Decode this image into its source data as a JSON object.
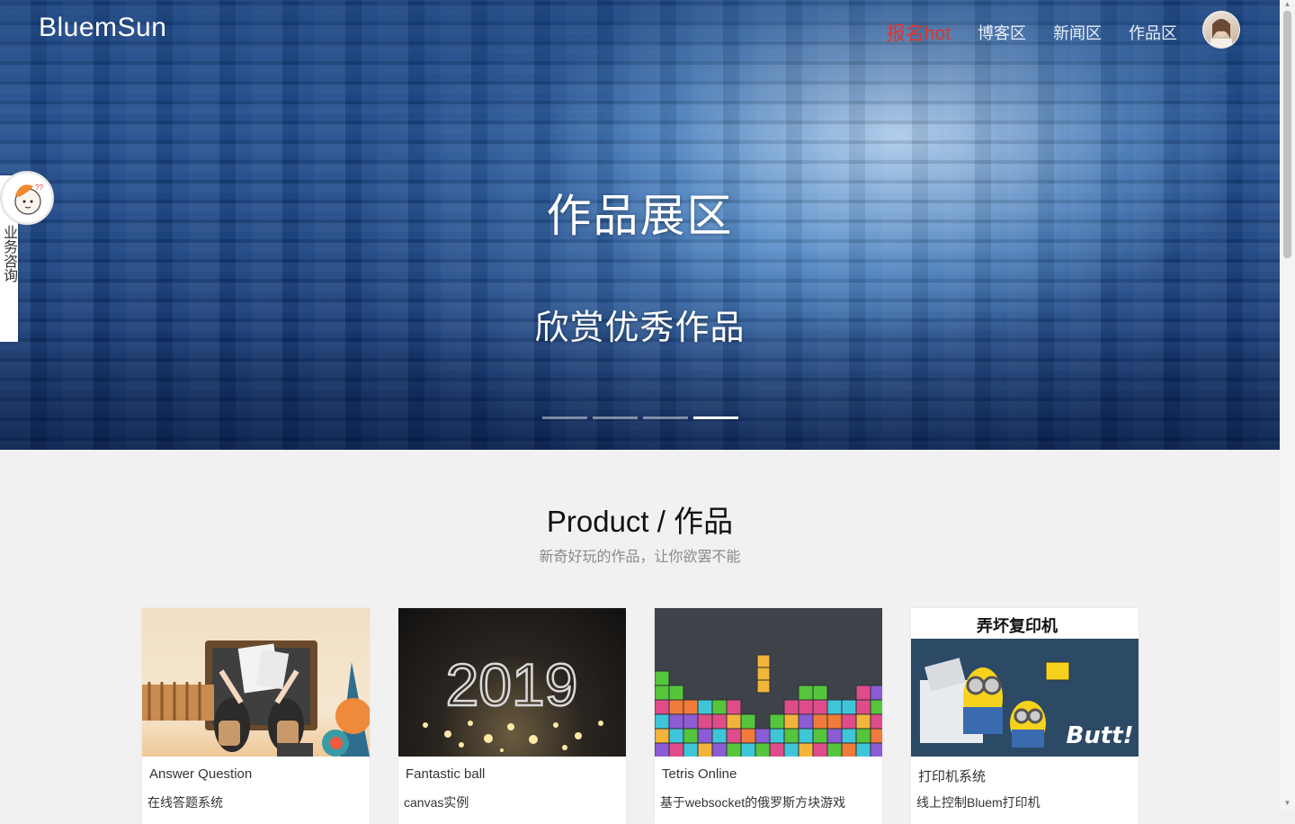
{
  "header": {
    "brand": "BluemSun",
    "nav": [
      {
        "label": "报名hot",
        "color": "#e0342d"
      },
      {
        "label": "博客区"
      },
      {
        "label": "新闻区"
      },
      {
        "label": "作品区"
      }
    ]
  },
  "hero": {
    "title": "作品展区",
    "subtitle": "欣赏优秀作品",
    "slides_total": 4,
    "active_slide": 4
  },
  "side_widget": {
    "text": "业务咨询"
  },
  "section": {
    "title": "Product / 作品",
    "subtitle": "新奇好玩的作品，让你欲罢不能"
  },
  "cards": [
    {
      "name": "Answer Question",
      "desc": "在线答题系统"
    },
    {
      "name": "Fantastic ball",
      "desc": "canvas实例",
      "image_text": "2019"
    },
    {
      "name": "Tetris Online",
      "desc": "基于websocket的俄罗斯方块游戏"
    },
    {
      "name": "打印机系统",
      "desc": "线上控制Bluem打印机",
      "image_text": "弄坏复印机",
      "image_caption": "Butt!"
    }
  ]
}
